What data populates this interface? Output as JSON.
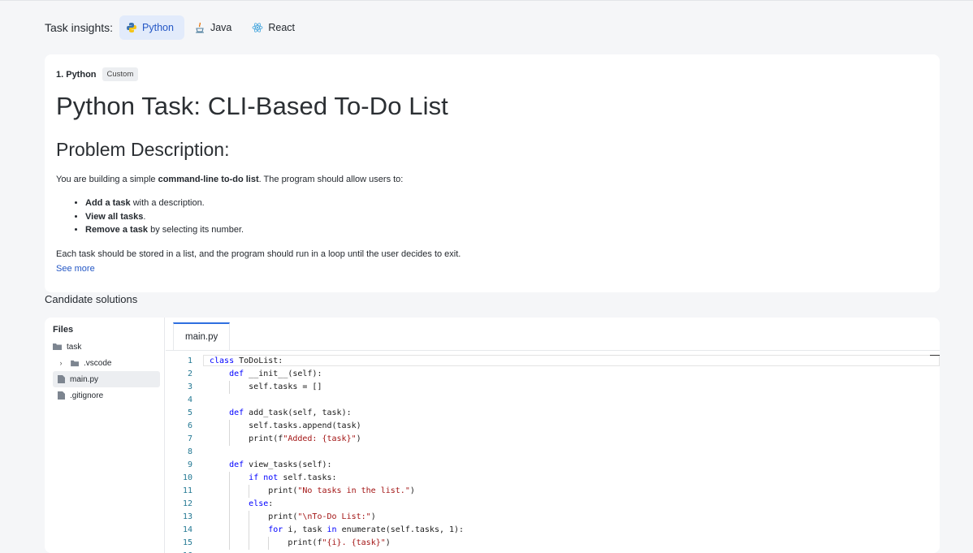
{
  "header": {
    "label": "Task insights:",
    "tabs": [
      {
        "label": "Python",
        "icon": "python-icon",
        "active": true
      },
      {
        "label": "Java",
        "icon": "java-icon",
        "active": false
      },
      {
        "label": "React",
        "icon": "react-icon",
        "active": false
      }
    ]
  },
  "task": {
    "breadcrumb": "1. Python",
    "badge": "Custom",
    "title": "Python Task: CLI-Based To-Do List",
    "heading": "Problem Description:",
    "intro_pre": "You are building a simple ",
    "intro_bold": "command-line to-do list",
    "intro_post": ". The program should allow users to:",
    "requirements": [
      {
        "bold": "Add a task",
        "rest": " with a description."
      },
      {
        "bold": "View all tasks",
        "rest": "."
      },
      {
        "bold": "Remove a task",
        "rest": " by selecting its number."
      }
    ],
    "note": "Each task should be stored in a list, and the program should run in a loop until the user decides to exit.",
    "see_more": "See more"
  },
  "solutions": {
    "label": "Candidate solutions",
    "files_title": "Files",
    "tree": [
      {
        "name": "task",
        "type": "folder-open"
      },
      {
        "name": ".vscode",
        "type": "folder"
      },
      {
        "name": "main.py",
        "type": "file",
        "selected": true
      },
      {
        "name": ".gitignore",
        "type": "file"
      }
    ],
    "tab": "main.py",
    "code": [
      "class ToDoList:",
      "    def __init__(self):",
      "        self.tasks = []",
      "",
      "    def add_task(self, task):",
      "        self.tasks.append(task)",
      "        print(f\"Added: {task}\")",
      "",
      "    def view_tasks(self):",
      "        if not self.tasks:",
      "            print(\"No tasks in the list.\")",
      "        else:",
      "            print(\"\\nTo-Do List:\")",
      "            for i, task in enumerate(self.tasks, 1):",
      "                print(f\"{i}. {task}\")",
      ""
    ]
  },
  "colors": {
    "accent": "#2457c5",
    "active_tab_bg": "#e2ebfb",
    "keyword": "#0000ff",
    "string": "#a31515",
    "line_number": "#237893"
  }
}
